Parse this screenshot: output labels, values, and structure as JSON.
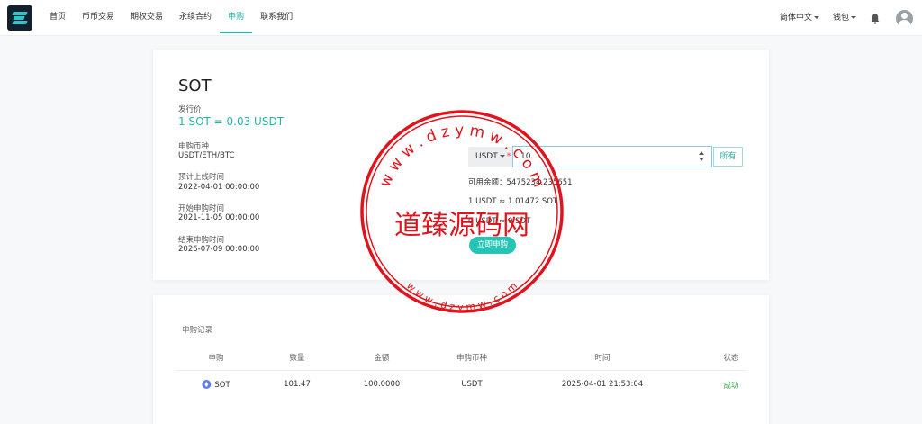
{
  "header": {
    "nav": [
      "首页",
      "币币交易",
      "期权交易",
      "永续合约",
      "申购",
      "联系我们"
    ],
    "active_index": 4,
    "language": "简体中文",
    "wallet": "钱包"
  },
  "subscription": {
    "coin": "SOT",
    "price_label": "发行价",
    "price": "1 SOT = 0.03 USDT",
    "currencies_label": "申购币种",
    "currencies": "USDT/ETH/BTC",
    "listing_label": "预计上线时间",
    "listing_time": "2022-04-01 00:00:00",
    "start_label": "开始申购时间",
    "start_time": "2021-11-05 00:00:00",
    "end_label": "结束申购时间",
    "end_time": "2026-07-09 00:00:00",
    "select_value": "USDT",
    "input_value": "10",
    "all_button": "所有",
    "available": "可用余额：5475234.235651",
    "rate": "1 USDT ≈ 1.01472 SOT",
    "estimate": "0 USDT ≈ 0 SOT",
    "buy_button": "立即申购"
  },
  "records": {
    "title": "申购记录",
    "columns": [
      "申购",
      "数量",
      "金额",
      "申购币种",
      "时间",
      "状态"
    ],
    "rows": [
      {
        "coin": "SOT",
        "quantity": "101.47",
        "amount": "100.0000",
        "currency": "USDT",
        "time": "2025-04-01 21:53:04",
        "status": "成功"
      }
    ]
  },
  "watermark": {
    "text": "道臻源码网",
    "url_top": "w w w . d z y m w . c o m",
    "url_bottom": "w w w . d z y m w . c o m"
  },
  "colors": {
    "accent": "#26b6ac",
    "success": "#3aa046",
    "stamp": "#e0141c"
  }
}
